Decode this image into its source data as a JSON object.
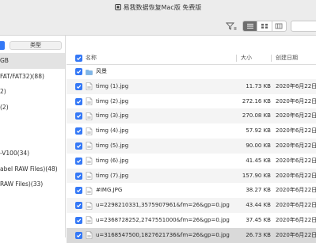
{
  "window": {
    "title": "易我数据恢复Mac版 免费版"
  },
  "toolbar": {
    "filter_icon": "filter-icon",
    "views": [
      "list-view",
      "grid-view",
      "column-view"
    ]
  },
  "sidebar": {
    "tab_types": "类型",
    "items": [
      "GB",
      "FAT/FAT32)(88)",
      "2)",
      "(2)",
      "",
      "",
      "-V100(34)",
      "abel RAW Files)(48)",
      "RAW Files)(33)"
    ]
  },
  "list": {
    "headers": {
      "name": "名称",
      "size": "大小",
      "date": "创建日期"
    },
    "rows": [
      {
        "name": "风景",
        "size": "",
        "date": "",
        "type": "folder"
      },
      {
        "name": "timg (1).jpg",
        "size": "11.73 KB",
        "date": "2020年6月22日",
        "type": "file"
      },
      {
        "name": "timg (2).jpg",
        "size": "272.16 KB",
        "date": "2020年6月22日",
        "type": "file"
      },
      {
        "name": "timg (3).jpg",
        "size": "270.08 KB",
        "date": "2020年6月22日",
        "type": "file"
      },
      {
        "name": "timg (4).jpg",
        "size": "57.92 KB",
        "date": "2020年6月22日",
        "type": "file"
      },
      {
        "name": "timg (5).jpg",
        "size": "90.00 KB",
        "date": "2020年6月22日",
        "type": "file"
      },
      {
        "name": "timg (6).jpg",
        "size": "41.45 KB",
        "date": "2020年6月22日",
        "type": "file"
      },
      {
        "name": "timg (7).jpg",
        "size": "157.90 KB",
        "date": "2020年6月22日",
        "type": "file"
      },
      {
        "name": "#IMG.JPG",
        "size": "38.27 KB",
        "date": "2020年6月22日",
        "type": "file"
      },
      {
        "name": "u=2298210331,3575907961&fm=26&gp=0.jpg",
        "size": "43.44 KB",
        "date": "2020年6月22日",
        "type": "file"
      },
      {
        "name": "u=2368728252,2747551000&fm=26&gp=0.jpg",
        "size": "37.45 KB",
        "date": "2020年6月22日",
        "type": "file"
      },
      {
        "name": "u=3168547500,1827621736&fm=26&gp=0.jpg",
        "size": "26.73 KB",
        "date": "2020年6月22日",
        "type": "file"
      }
    ]
  },
  "colors": {
    "accent": "#3478f6",
    "folder": "#7fb6e8"
  }
}
